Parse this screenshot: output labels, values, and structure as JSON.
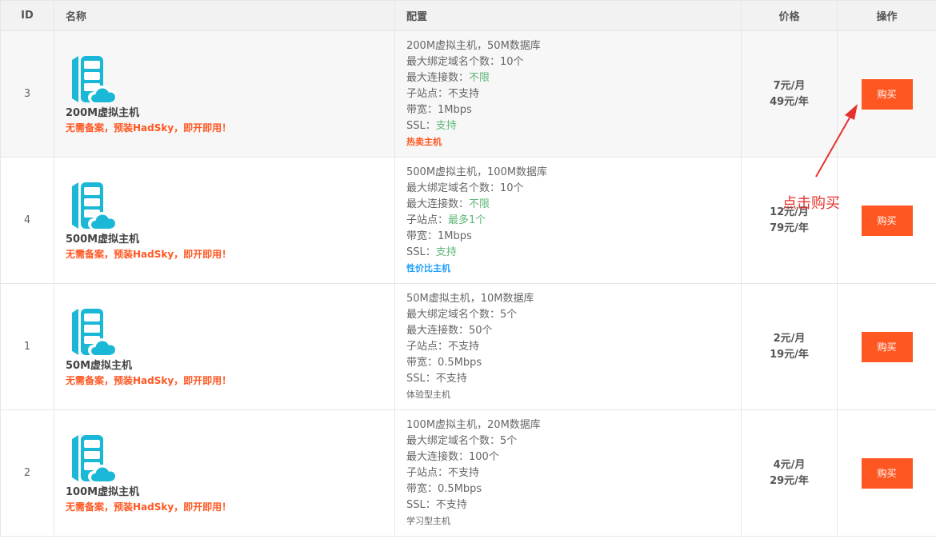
{
  "header": {
    "col_id": "ID",
    "col_name": "名称",
    "col_config": "配置",
    "col_price": "价格",
    "col_action": "操作"
  },
  "logo_icon": "server-cloud-icon",
  "colors": {
    "accent": "#ff5722",
    "logo": "#1ab8d6",
    "green": "#5fb878",
    "blue": "#1e9fff"
  },
  "rows": [
    {
      "id": "3",
      "name": "200M虚拟主机",
      "desc": "无需备案，预装HadSky，即开即用！",
      "config": [
        {
          "label": "200M虚拟主机，50M数据库",
          "value": ""
        },
        {
          "label": "最大绑定域名个数：",
          "value": "10个"
        },
        {
          "label": "最大连接数：",
          "value": "不限"
        },
        {
          "label": "子站点：",
          "value": "不支持"
        },
        {
          "label": "带宽：",
          "value": "1Mbps"
        },
        {
          "label": "SSL：",
          "value": "支持"
        }
      ],
      "tag": "热卖主机",
      "price_month": "7元/月",
      "price_year": "49元/年",
      "buy_label": "购买"
    },
    {
      "id": "4",
      "name": "500M虚拟主机",
      "desc": "无需备案，预装HadSky，即开即用！",
      "config": [
        {
          "label": "500M虚拟主机，100M数据库",
          "value": ""
        },
        {
          "label": "最大绑定域名个数：",
          "value": "10个"
        },
        {
          "label": "最大连接数：",
          "value": "不限"
        },
        {
          "label": "子站点：",
          "value": "最多1个"
        },
        {
          "label": "带宽：",
          "value": "1Mbps"
        },
        {
          "label": "SSL：",
          "value": "支持"
        }
      ],
      "tag": "性价比主机",
      "price_month": "12元/月",
      "price_year": "79元/年",
      "buy_label": "购买"
    },
    {
      "id": "1",
      "name": "50M虚拟主机",
      "desc": "无需备案，预装HadSky，即开即用！",
      "config": [
        {
          "label": "50M虚拟主机，10M数据库",
          "value": ""
        },
        {
          "label": "最大绑定域名个数：",
          "value": "5个"
        },
        {
          "label": "最大连接数：",
          "value": "50个"
        },
        {
          "label": "子站点：",
          "value": "不支持"
        },
        {
          "label": "带宽：",
          "value": "0.5Mbps"
        },
        {
          "label": "SSL：",
          "value": "不支持"
        }
      ],
      "tag": "体验型主机",
      "price_month": "2元/月",
      "price_year": "19元/年",
      "buy_label": "购买"
    },
    {
      "id": "2",
      "name": "100M虚拟主机",
      "desc": "无需备案，预装HadSky，即开即用！",
      "config": [
        {
          "label": "100M虚拟主机，20M数据库",
          "value": ""
        },
        {
          "label": "最大绑定域名个数：",
          "value": "5个"
        },
        {
          "label": "最大连接数：",
          "value": "100个"
        },
        {
          "label": "子站点：",
          "value": "不支持"
        },
        {
          "label": "带宽：",
          "value": "0.5Mbps"
        },
        {
          "label": "SSL：",
          "value": "不支持"
        }
      ],
      "tag": "学习型主机",
      "price_month": "4元/月",
      "price_year": "29元/年",
      "buy_label": "购买"
    }
  ],
  "annotation": {
    "text": "点击购买",
    "icon": "red-arrow-icon",
    "color": "#e6322d"
  }
}
